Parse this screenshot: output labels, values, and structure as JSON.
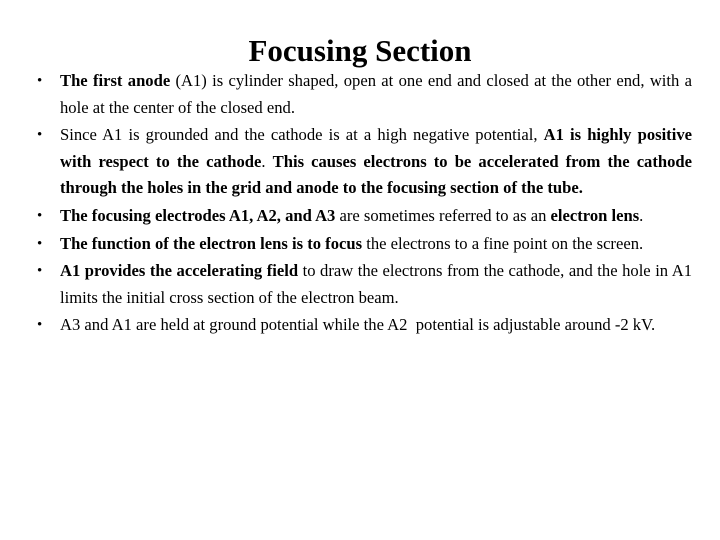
{
  "slide": {
    "title": "Focusing Section",
    "background_color": "#ffffff",
    "text_color": "#000000",
    "bullet_glyph": "•",
    "bullets": [
      {
        "id": "bullet-first-anode",
        "runs": [
          {
            "text": "The first anode",
            "bold": true
          },
          {
            "text": " (A1) is cylinder shaped, open at one end and closed at the other end, with a hole at the center of the closed end.",
            "bold": false
          }
        ]
      },
      {
        "id": "bullet-a1-grounded",
        "runs": [
          {
            "text": "Since A1 is grounded and the cathode is at a high negative potential, ",
            "bold": false
          },
          {
            "text": "A1 is highly positive with respect to the cathode",
            "bold": true
          },
          {
            "text": ". ",
            "bold": false
          },
          {
            "text": "This causes electrons to be accelerated from the cathode through the holes in the grid and anode to the focusing section of the tube.",
            "bold": true
          }
        ]
      },
      {
        "id": "bullet-focusing-electrodes",
        "runs": [
          {
            "text": "The focusing electrodes A1, A2, and A3",
            "bold": true
          },
          {
            "text": " are sometimes referred to as an ",
            "bold": false
          },
          {
            "text": "electron lens",
            "bold": true
          },
          {
            "text": ".",
            "bold": false
          }
        ]
      },
      {
        "id": "bullet-electron-lens-function",
        "runs": [
          {
            "text": "The function of the electron lens is to focus",
            "bold": true
          },
          {
            "text": " the electrons to a fine point on the screen.",
            "bold": false
          }
        ]
      },
      {
        "id": "bullet-accelerating-field",
        "runs": [
          {
            "text": "A1 provides the accelerating field",
            "bold": true
          },
          {
            "text": " to draw the electrons from the cathode, and the hole in A1 limits the initial cross section of the electron beam.",
            "bold": false
          }
        ]
      },
      {
        "id": "bullet-ground-potential",
        "runs": [
          {
            "text": "A3 and A1 are held at ground potential while the A2  potential is adjustable around -2 kV.",
            "bold": false
          }
        ]
      }
    ]
  }
}
